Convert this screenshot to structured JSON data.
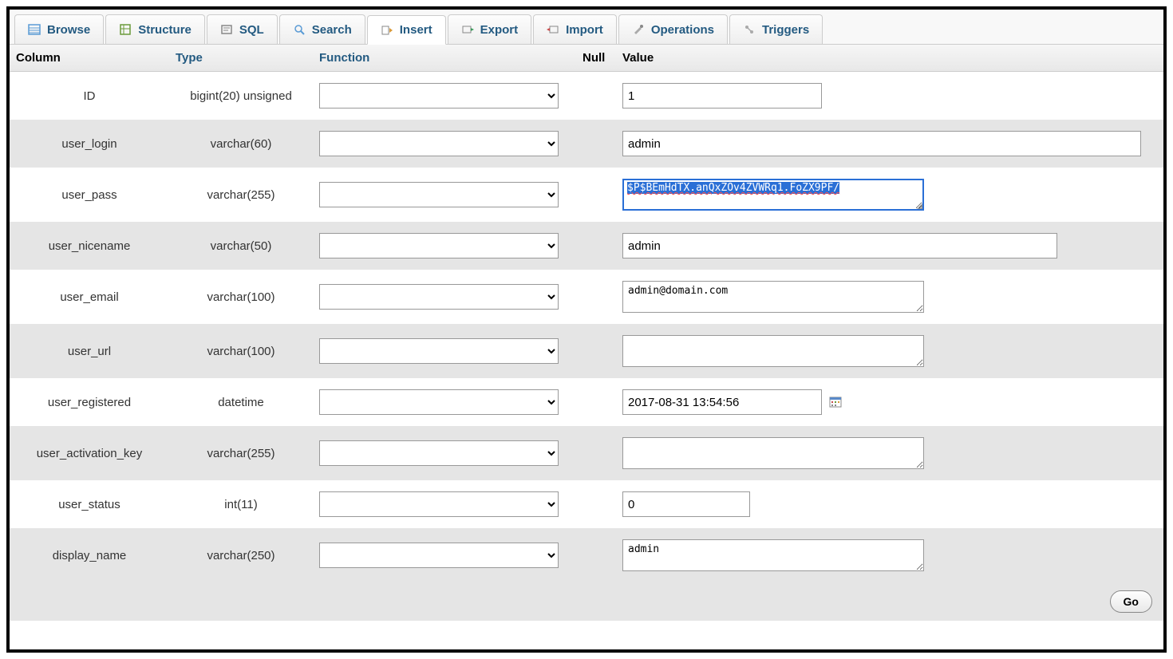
{
  "tabs": [
    {
      "label": "Browse",
      "icon": "browse-icon"
    },
    {
      "label": "Structure",
      "icon": "structure-icon"
    },
    {
      "label": "SQL",
      "icon": "sql-icon"
    },
    {
      "label": "Search",
      "icon": "search-icon"
    },
    {
      "label": "Insert",
      "icon": "insert-icon",
      "active": true
    },
    {
      "label": "Export",
      "icon": "export-icon"
    },
    {
      "label": "Import",
      "icon": "import-icon"
    },
    {
      "label": "Operations",
      "icon": "operations-icon"
    },
    {
      "label": "Triggers",
      "icon": "triggers-icon"
    }
  ],
  "headers": {
    "column": "Column",
    "type": "Type",
    "function": "Function",
    "null": "Null",
    "value": "Value"
  },
  "rows": [
    {
      "name": "ID",
      "type": "bigint(20) unsigned",
      "value": "1",
      "control": "input-small"
    },
    {
      "name": "user_login",
      "type": "varchar(60)",
      "value": "admin",
      "control": "input-wide"
    },
    {
      "name": "user_pass",
      "type": "varchar(255)",
      "value": "$P$BEmHdTX.anQxZOv4ZVWRq1.FoZX9PF/",
      "control": "textarea-selected"
    },
    {
      "name": "user_nicename",
      "type": "varchar(50)",
      "value": "admin",
      "control": "input-mid"
    },
    {
      "name": "user_email",
      "type": "varchar(100)",
      "value": "admin@domain.com",
      "control": "textarea"
    },
    {
      "name": "user_url",
      "type": "varchar(100)",
      "value": "",
      "control": "textarea"
    },
    {
      "name": "user_registered",
      "type": "datetime",
      "value": "2017-08-31 13:54:56",
      "control": "input-date"
    },
    {
      "name": "user_activation_key",
      "type": "varchar(255)",
      "value": "",
      "control": "textarea"
    },
    {
      "name": "user_status",
      "type": "int(11)",
      "value": "0",
      "control": "input-xsmall"
    },
    {
      "name": "display_name",
      "type": "varchar(250)",
      "value": "admin",
      "control": "textarea"
    }
  ],
  "footer": {
    "go": "Go"
  }
}
